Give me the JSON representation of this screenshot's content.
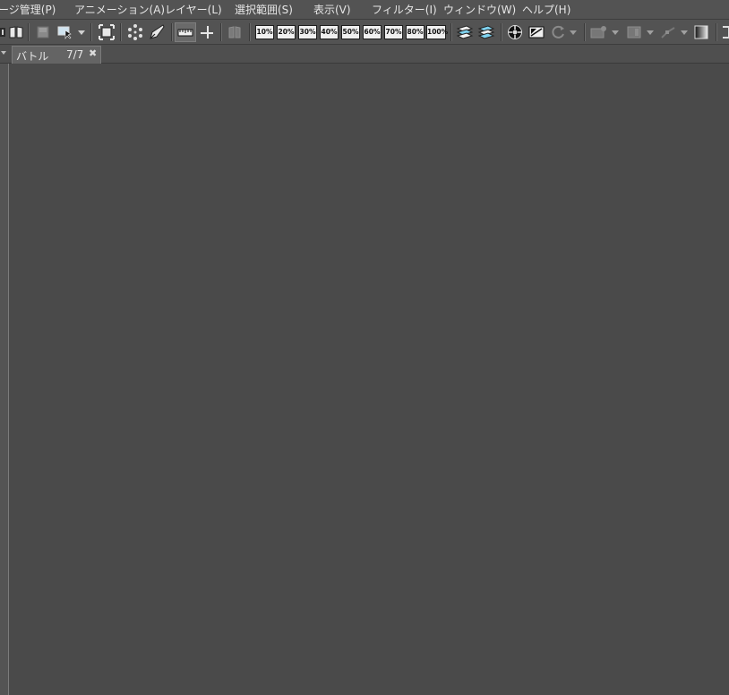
{
  "menu": [
    {
      "label": "ージ管理(P)"
    },
    {
      "label": "アニメーション(A)"
    },
    {
      "label": "レイヤー(L)"
    },
    {
      "label": "選択範囲(S)"
    },
    {
      "label": "表示(V)"
    },
    {
      "label": "フィルター(I)"
    },
    {
      "label": "ウィンドウ(W)"
    },
    {
      "label": "ヘルプ(H)"
    }
  ],
  "zoom_presets": [
    "10%",
    "20%",
    "30%",
    "40%",
    "50%",
    "60%",
    "70%",
    "80%",
    "100%"
  ],
  "document_tab": {
    "title": "バトル",
    "page_count": "7/7",
    "close_glyph": "✖"
  },
  "colors": {
    "ui_gray": "#535353",
    "canvas_gray": "#4a4a4a",
    "highlight_blue": "#7fd3f0"
  }
}
